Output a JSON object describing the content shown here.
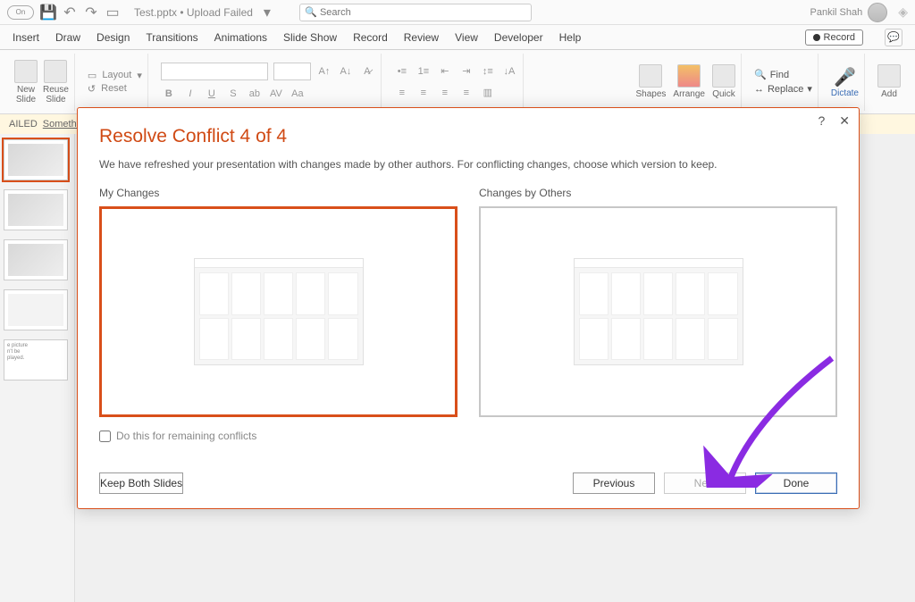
{
  "titlebar": {
    "autosave": "On",
    "filename": "Test.pptx • Upload Failed",
    "search_placeholder": "Search",
    "username": "Pankil Shah"
  },
  "ribbon_tabs": [
    "Insert",
    "Draw",
    "Design",
    "Transitions",
    "Animations",
    "Slide Show",
    "Record",
    "Review",
    "View",
    "Developer",
    "Help"
  ],
  "record_button": "Record",
  "ribbon": {
    "new_slide": "New\nSlide",
    "reuse_slides": "Reuse\nSlide",
    "layout": "Layout",
    "reset": "Reset",
    "shapes": "Shapes",
    "arrange": "Arrange",
    "quick": "Quick",
    "find": "Find",
    "replace": "Replace",
    "dictate": "Dictate",
    "addins": "Add"
  },
  "statusbar": {
    "failed": "AILED",
    "something": "Somethin"
  },
  "dialog": {
    "title": "Resolve Conflict 4 of 4",
    "subtitle": "We have refreshed your presentation with changes made by other authors. For conflicting changes, choose which version to keep.",
    "my_changes": "My Changes",
    "others_changes": "Changes by Others",
    "do_remaining": "Do this for remaining conflicts",
    "keep_both": "Keep Both Slides",
    "previous": "Previous",
    "next": "Next",
    "done": "Done",
    "help": "?",
    "close": "✕"
  },
  "thumb_warning": "e picture\nn't be\nplayed."
}
